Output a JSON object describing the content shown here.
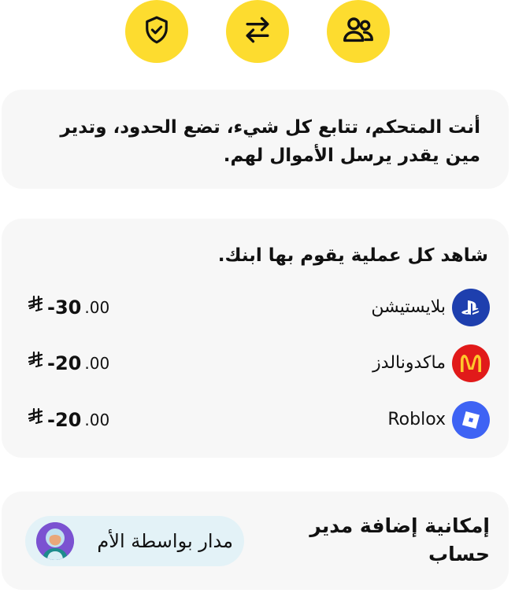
{
  "top_icons": [
    {
      "icon": "shield-check-icon"
    },
    {
      "icon": "transfer-arrows-icon"
    },
    {
      "icon": "users-icon"
    }
  ],
  "control": {
    "text": "أنت المتحكم،  تتابع كل شيء، تضع الحدود، وتدير مين يقدر يرسل الأموال لهم."
  },
  "transactions": {
    "title": "شاهد كل عملية يقوم بها ابنك.",
    "items": [
      {
        "name": "بلايستيشن",
        "logo": "playstation-logo",
        "amount_main": "-30",
        "amount_decimal": ".00",
        "currency": "riyal-icon"
      },
      {
        "name": "ماكدونالدز",
        "logo": "mcdonalds-logo",
        "amount_main": "-20",
        "amount_decimal": ".00",
        "currency": "riyal-icon"
      },
      {
        "name": "Roblox",
        "logo": "roblox-logo",
        "amount_main": "-20",
        "amount_decimal": ".00",
        "currency": "riyal-icon"
      }
    ]
  },
  "manager": {
    "title": "إمكانية إضافة مدير حساب",
    "badge_label": "مدار بواسطة الأم"
  },
  "colors": {
    "accent_yellow": "#FDDC2F",
    "playstation": "#1E3FAE",
    "mcdonalds": "#E11A1A",
    "roblox": "#3E63F4"
  }
}
